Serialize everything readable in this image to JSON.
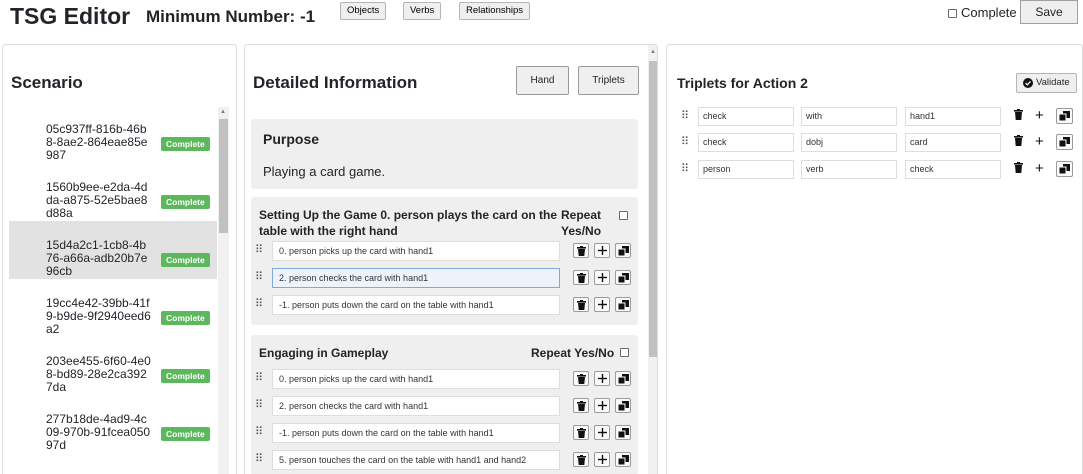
{
  "header": {
    "app_title": "TSG Editor",
    "min_number": "Minimum Number: -1",
    "nav_buttons": [
      "Objects",
      "Verbs",
      "Relationships"
    ],
    "complete_label": "Complete",
    "save_label": "Save"
  },
  "scenario": {
    "title": "Scenario",
    "items": [
      {
        "id": "05c937ff-816b-46b8-8ae2-864eae85e987",
        "status": "Complete",
        "selected": false
      },
      {
        "id": "1560b9ee-e2da-4dda-a875-52e5bae8d88a",
        "status": "Complete",
        "selected": false
      },
      {
        "id": "15d4a2c1-1cb8-4b76-a66a-adb20b7e96cb",
        "status": "Complete",
        "selected": true
      },
      {
        "id": "19cc4e42-39bb-41f9-b9de-9f2940eed6a2",
        "status": "Complete",
        "selected": false
      },
      {
        "id": "203ee455-6f60-4e08-bd89-28e2ca3927da",
        "status": "Complete",
        "selected": false
      },
      {
        "id": "277b18de-4ad9-4c09-970b-91fcea05097d",
        "status": "Complete",
        "selected": false
      }
    ]
  },
  "detail": {
    "title": "Detailed Information",
    "hand_label": "Hand",
    "triplets_label": "Triplets",
    "purpose_heading": "Purpose",
    "purpose_text": "Playing a card game.",
    "steps": [
      {
        "heading": "Setting Up the Game 0. person plays the card on the table with the right hand",
        "repeat_label": "Repeat Yes/No",
        "actions": [
          "0. person picks up the card with hand1",
          "2. person checks the card with hand1",
          "-1. person puts down the card on the table with hand1"
        ]
      },
      {
        "heading": "Engaging in Gameplay",
        "repeat_label": "Repeat Yes/No",
        "actions": [
          "0. person picks up the card with hand1",
          "2. person checks the card with hand1",
          "-1. person puts down the card on the table with hand1",
          "5. person touches the card on the table with hand1 and hand2"
        ]
      }
    ]
  },
  "triplets": {
    "title": "Triplets for Action 2",
    "validate_label": "Validate",
    "rows": [
      [
        "check",
        "with",
        "hand1"
      ],
      [
        "check",
        "dobj",
        "card"
      ],
      [
        "person",
        "verb",
        "check"
      ]
    ]
  },
  "colors": {
    "badge": "#5cb85c",
    "selected_row": "#e2e2e2",
    "card_bg": "#efefef"
  }
}
